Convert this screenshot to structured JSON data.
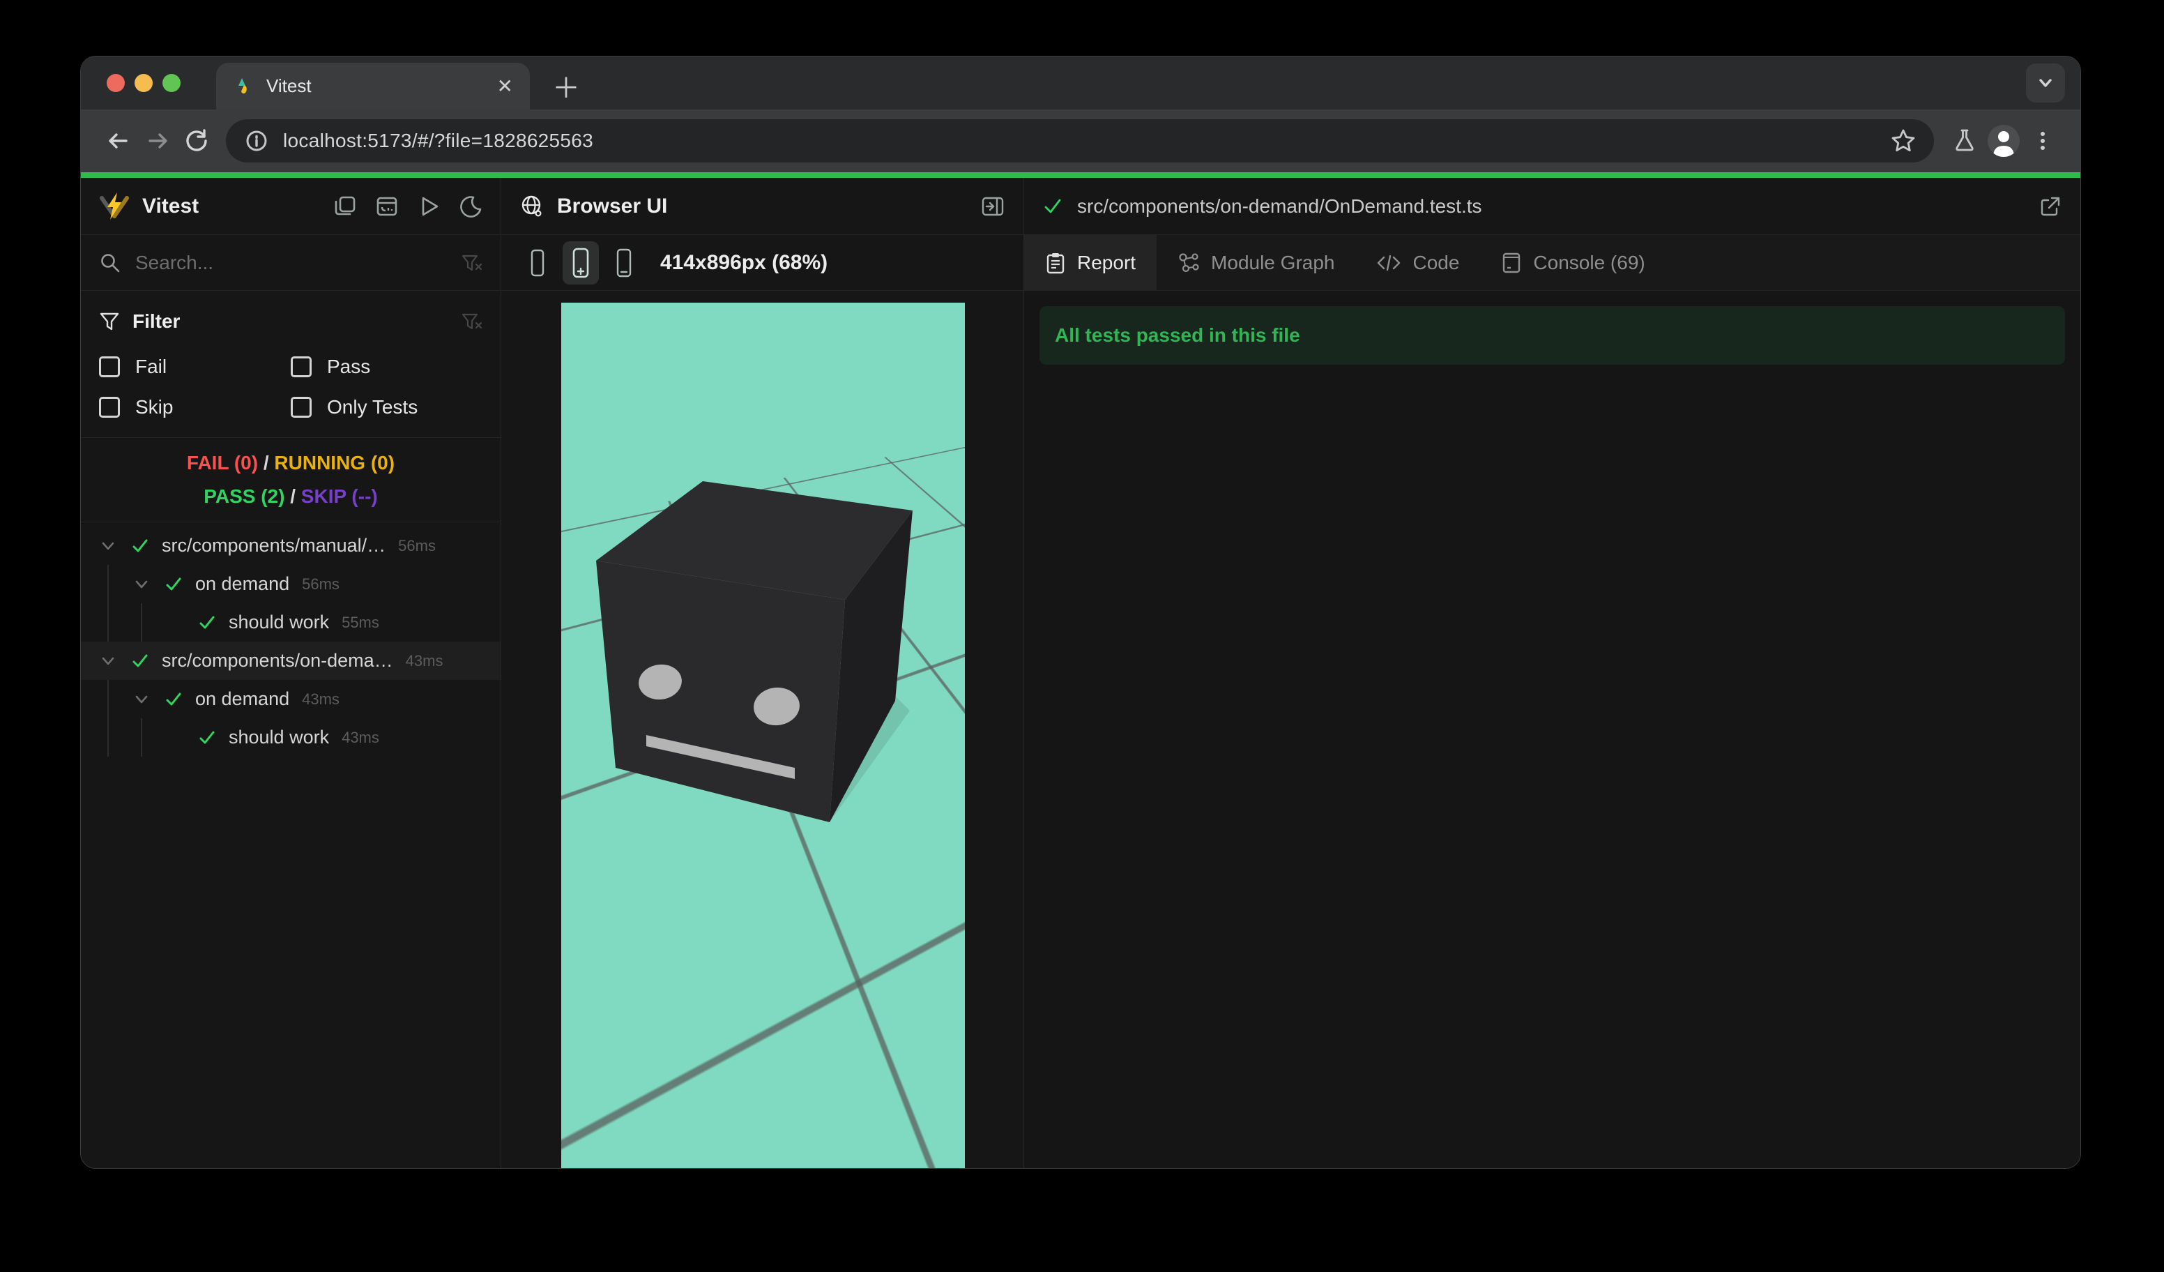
{
  "browser": {
    "tab_title": "Vitest",
    "close_label": "✕",
    "new_tab_label": "＋",
    "url": "localhost:5173/#/?file=1828625563"
  },
  "sidebar": {
    "app_name": "Vitest",
    "search_placeholder": "Search...",
    "filter": {
      "title": "Filter",
      "options": [
        {
          "label": "Fail"
        },
        {
          "label": "Pass"
        },
        {
          "label": "Skip"
        },
        {
          "label": "Only Tests"
        }
      ]
    },
    "stats": {
      "fail": "FAIL (0)",
      "sep1": " / ",
      "running": "RUNNING (0)",
      "pass": "PASS (2)",
      "sep2": " / ",
      "skip": "SKIP (--)"
    },
    "tree": {
      "rows": [
        {
          "label": "src/components/manual/…",
          "duration": "56ms"
        },
        {
          "label": "on demand",
          "duration": "56ms"
        },
        {
          "label": "should work",
          "duration": "55ms"
        },
        {
          "label": "src/components/on-dema…",
          "duration": "43ms"
        },
        {
          "label": "on demand",
          "duration": "43ms"
        },
        {
          "label": "should work",
          "duration": "43ms"
        }
      ]
    }
  },
  "browser_panel": {
    "title": "Browser UI",
    "size_label": "414x896px (68%)"
  },
  "report_panel": {
    "file_path": "src/components/on-demand/OnDemand.test.ts",
    "tabs": [
      {
        "label": "Report"
      },
      {
        "label": "Module Graph"
      },
      {
        "label": "Code"
      },
      {
        "label": "Console (69)"
      }
    ],
    "banner": "All tests passed in this file"
  },
  "colors": {
    "accent_green": "#2dbd4c",
    "pass_green": "#31d462",
    "fail_red": "#f8514f",
    "running_yellow": "#e9b10e",
    "skip_purple": "#7740c9",
    "mint": "#80dac1",
    "banner_bg": "#17271d",
    "banner_text": "#32b554"
  }
}
